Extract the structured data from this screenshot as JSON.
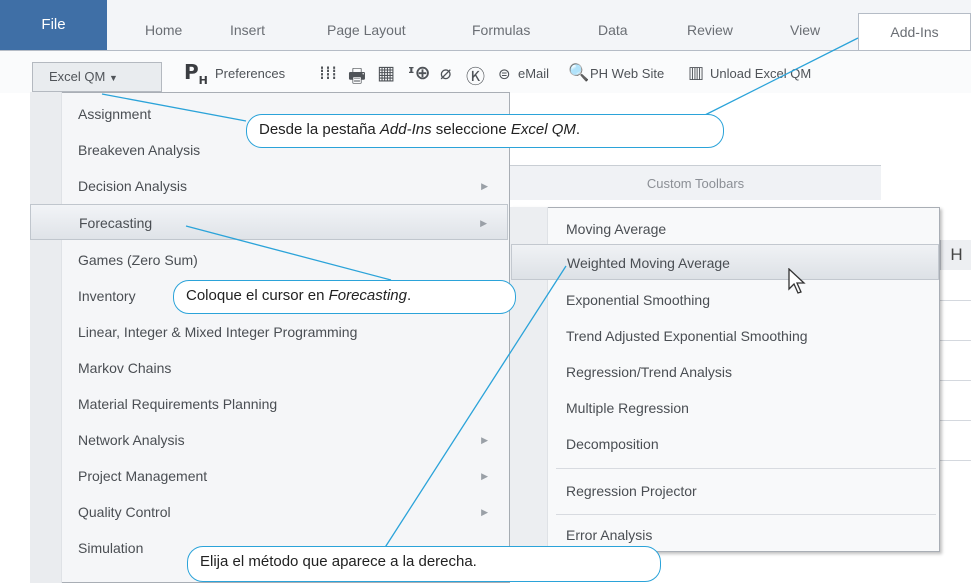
{
  "ribbon": {
    "tabs": [
      "File",
      "Home",
      "Insert",
      "Page Layout",
      "Formulas",
      "Data",
      "Review",
      "View",
      "Add-Ins"
    ]
  },
  "toolbar": {
    "excel_qm_label": "Excel QM",
    "preferences_label": "Preferences",
    "email_label": "eMail",
    "ph_web_site_label": "PH Web Site",
    "unload_label": "Unload Excel QM",
    "custom_toolbars_label": "Custom Toolbars"
  },
  "menu": {
    "items": [
      "Assignment",
      "Breakeven Analysis",
      "Decision Analysis",
      "Forecasting",
      "Games (Zero Sum)",
      "Inventory",
      "Linear, Integer & Mixed Integer Programming",
      "Markov Chains",
      "Material Requirements Planning",
      "Network Analysis",
      "Project Management",
      "Quality Control",
      "Simulation"
    ],
    "highlighted": "Forecasting"
  },
  "submenu": {
    "items": [
      "Moving Average",
      "Weighted Moving Average",
      "Exponential Smoothing",
      "Trend Adjusted Exponential Smoothing",
      "Regression/Trend Analysis",
      "Multiple Regression",
      "Decomposition",
      "Regression Projector",
      "Error Analysis"
    ],
    "highlighted": "Weighted Moving Average"
  },
  "sheet": {
    "column_header": "H"
  },
  "callouts": {
    "c1": {
      "pre": "Desde la pestaña ",
      "em1": "Add-Ins",
      "mid": " seleccione ",
      "em2": "Excel QM",
      "post": "."
    },
    "c2": {
      "pre": "Coloque el cursor en ",
      "em1": "Forecasting",
      "post": "."
    },
    "c3": {
      "text": "Elija el método que aparece a la derecha."
    }
  },
  "colors": {
    "accent": "#2ba3d9",
    "file_tab": "#3f6fa6"
  }
}
